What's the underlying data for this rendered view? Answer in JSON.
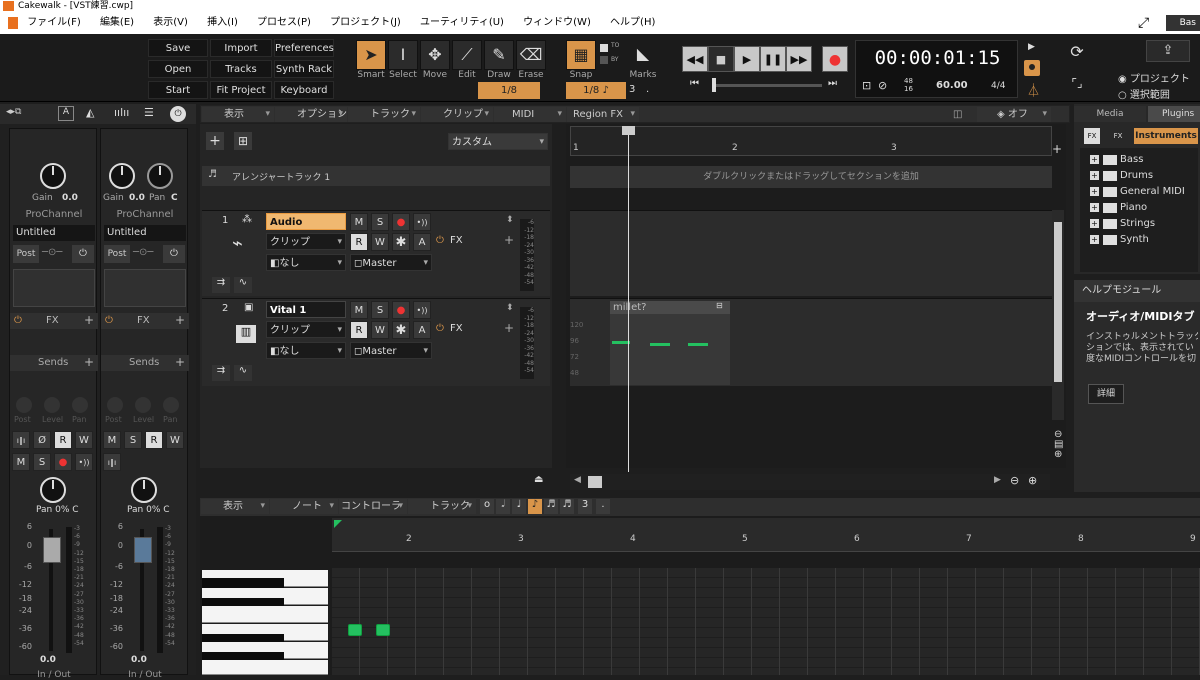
{
  "window": {
    "title": "Cakewalk - [VST練習.cwp]"
  },
  "menu": [
    "ファイル(F)",
    "編集(E)",
    "表示(V)",
    "挿入(I)",
    "プロセス(P)",
    "プロジェクト(J)",
    "ユーティリティ(U)",
    "ウィンドウ(W)",
    "ヘルプ(H)"
  ],
  "menu_right_label": "Bas",
  "control_buttons": [
    [
      "Save",
      "Import",
      "Preferences"
    ],
    [
      "Open",
      "Tracks",
      "Synth Rack"
    ],
    [
      "Start Screen",
      "Fit Project",
      "Keyboard"
    ]
  ],
  "tools": [
    {
      "label": "Smart",
      "icon": "cursor-arrow",
      "active": true
    },
    {
      "label": "Select",
      "icon": "i-beam"
    },
    {
      "label": "Move",
      "icon": "move-arrows"
    },
    {
      "label": "Edit",
      "icon": "edit-tool"
    },
    {
      "label": "Draw",
      "icon": "pencil"
    },
    {
      "label": "Erase",
      "icon": "eraser"
    }
  ],
  "snap": {
    "label": "Snap",
    "value": "1/8",
    "to_label": "TO",
    "by_label": "BY"
  },
  "marks": {
    "label": "Marks",
    "value": "1/8",
    "extra": "3"
  },
  "transport": {
    "time": "00:00:01:15",
    "sample_rate": "48",
    "bit_depth": "16",
    "tempo": "60.00",
    "meter": "4/4"
  },
  "scope": {
    "project": "プロジェクト",
    "selection": "選択範囲"
  },
  "track_header": {
    "menus": [
      "表示",
      "オプション",
      "トラック",
      "クリップ",
      "MIDI",
      "Region FX"
    ],
    "off_label": "オフ",
    "custom": "カスタム"
  },
  "arranger": {
    "name": "アレンジャートラック 1",
    "hint": "ダブルクリックまたはドラッグしてセクションを追加"
  },
  "ruler_marks": [
    "1",
    "2",
    "3"
  ],
  "tracks": [
    {
      "num": "1",
      "name": "Audio",
      "selected": true,
      "clip": "クリップ",
      "input": "なし",
      "output": "Master",
      "fx": "FX"
    },
    {
      "num": "2",
      "name": "Vital 1",
      "selected": false,
      "clip": "クリップ",
      "input": "なし",
      "output": "Master",
      "fx": "FX"
    }
  ],
  "meter_scale": [
    "-6",
    "-12",
    "-18",
    "-24",
    "-30",
    "-36",
    "-42",
    "-48",
    "-54"
  ],
  "clip": {
    "name": "millet?"
  },
  "midi_scale": [
    "120",
    "96",
    "72",
    "48"
  ],
  "strips": [
    {
      "gain": "0.0",
      "pan_label": "",
      "pan_value": "",
      "proc": "ProChannel",
      "preset": "Untitled",
      "post": "Post",
      "fx": "FX",
      "sends": "Sends",
      "pan": "Pan 0% C",
      "vol": "0.0",
      "io": "In / Out"
    },
    {
      "gain": "0.0",
      "pan_label": "Pan",
      "pan_value": "C",
      "proc": "ProChannel",
      "preset": "Untitled",
      "post": "Post",
      "fx": "FX",
      "sends": "Sends",
      "pan": "Pan 0% C",
      "vol": "0.0",
      "io": "In / Out"
    }
  ],
  "strip_labels": {
    "gain": "Gain",
    "post_small": "Post",
    "level": "Level",
    "pan_small": "Pan"
  },
  "strip_buttons": {
    "row1": [
      "M",
      "S",
      "R",
      "W"
    ],
    "row1b": [
      "M",
      "S",
      "R",
      "W"
    ]
  },
  "fader_scale": [
    "6",
    "0",
    "-6",
    "-12",
    "-18",
    "-24",
    "-36",
    "-60"
  ],
  "meter_scale_small": [
    "-3",
    "-6",
    "-9",
    "-12",
    "-15",
    "-18",
    "-21",
    "-24",
    "-27",
    "-30",
    "-33",
    "-36",
    "-42",
    "-48",
    "-54"
  ],
  "browser": {
    "tabs": [
      "Media",
      "Plugins"
    ],
    "subtabs": [
      "FX",
      "FX",
      "Instruments"
    ],
    "items": [
      "Bass",
      "Drums",
      "General MIDI",
      "Piano",
      "Strings",
      "Synth"
    ]
  },
  "help": {
    "title": "ヘルプモジュール",
    "heading": "オーディオ/MIDIタブ",
    "body": "インストゥルメントトラックを\nションでは、表示されてい\n度なMIDIコントロールを切",
    "button": "詳細"
  },
  "pianoroll": {
    "menus": [
      "表示",
      "ノート",
      "コントローラ",
      "トラック"
    ],
    "extra": "3",
    "ruler_marks": [
      "2",
      "3",
      "4",
      "5",
      "6",
      "7",
      "8",
      "9"
    ]
  },
  "colors": {
    "accent": "#d9954a",
    "note": "#24c060",
    "record": "#e33333"
  }
}
